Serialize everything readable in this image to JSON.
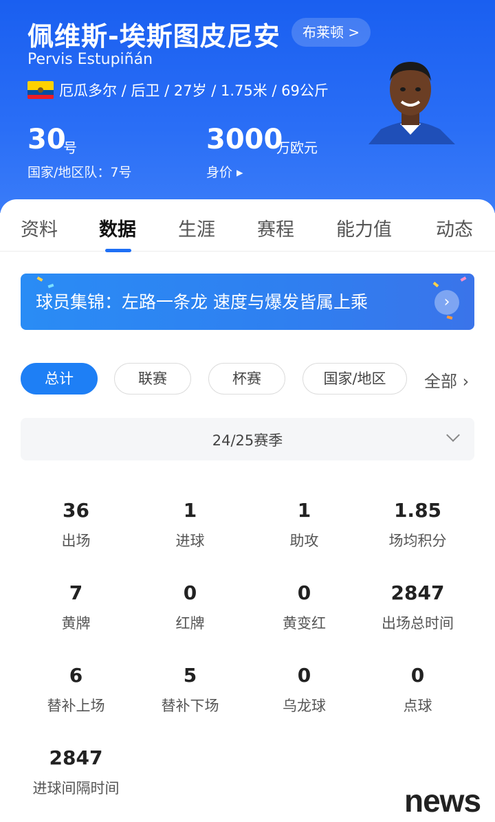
{
  "player": {
    "name_cn": "佩维斯-埃斯图皮尼安",
    "club_link": "布莱顿 >",
    "name_en": "Pervis Estupiñán",
    "info": "厄瓜多尔 / 后卫 / 27岁 / 1.75米 / 69公斤",
    "flag_icon": "ecuador-flag-icon",
    "number": "30",
    "number_unit": "号",
    "national_number": "国家/地区队：7号",
    "value": "3000",
    "value_unit": "万欧元",
    "value_label": "身价 ▸"
  },
  "tabs": [
    "资料",
    "数据",
    "生涯",
    "赛程",
    "能力值",
    "动态"
  ],
  "active_tab": "数据",
  "banner": {
    "text": "球员集锦：左路一条龙 速度与爆发皆属上乘",
    "arrow": "›"
  },
  "filters": [
    "总计",
    "联赛",
    "杯赛",
    "国家/地区"
  ],
  "filter_more": "全部 ›",
  "season": "24/25赛季",
  "stats": [
    {
      "value": "36",
      "label": "出场"
    },
    {
      "value": "1",
      "label": "进球"
    },
    {
      "value": "1",
      "label": "助攻"
    },
    {
      "value": "1.85",
      "label": "场均积分"
    },
    {
      "value": "7",
      "label": "黄牌"
    },
    {
      "value": "0",
      "label": "红牌"
    },
    {
      "value": "0",
      "label": "黄变红"
    },
    {
      "value": "2847",
      "label": "出场总时间"
    },
    {
      "value": "6",
      "label": "替补上场"
    },
    {
      "value": "5",
      "label": "替补下场"
    },
    {
      "value": "0",
      "label": "乌龙球"
    },
    {
      "value": "0",
      "label": "点球"
    },
    {
      "value": "2847",
      "label": "进球间隔时间"
    }
  ],
  "watermark": "news",
  "colors": {
    "header_blue": "#1a5ff0",
    "accent_blue": "#1e7ff5",
    "flag_yellow": "#ffd100",
    "flag_blue": "#034ea2",
    "flag_red": "#ed1c24"
  }
}
